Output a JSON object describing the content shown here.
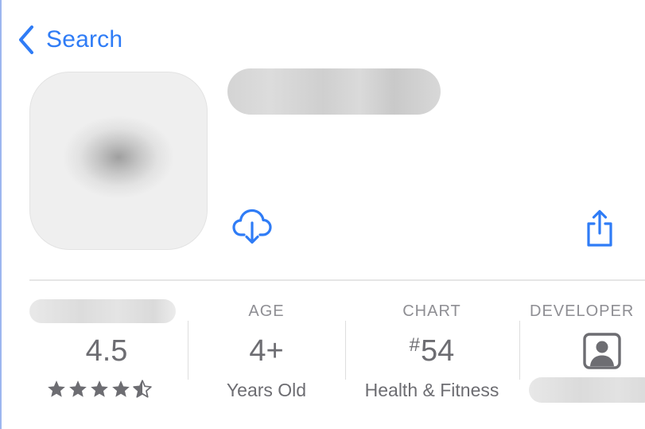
{
  "nav": {
    "back_label": "Search"
  },
  "colors": {
    "accent": "#2f7cf6",
    "secondary_text": "#6d6d72",
    "header_text": "#8e8e93"
  },
  "icons": {
    "back": "chevron-left-icon",
    "download": "cloud-download-icon",
    "share": "share-icon",
    "developer": "person-square-icon",
    "rating": "star-icon"
  },
  "info": {
    "rating": {
      "value": "4.5",
      "stars": 4.5
    },
    "age": {
      "header": "AGE",
      "value": "4+",
      "sub": "Years Old"
    },
    "chart": {
      "header": "CHART",
      "hash": "#",
      "value": "54",
      "sub": "Health & Fitness"
    },
    "developer": {
      "header": "DEVELOPER"
    }
  }
}
